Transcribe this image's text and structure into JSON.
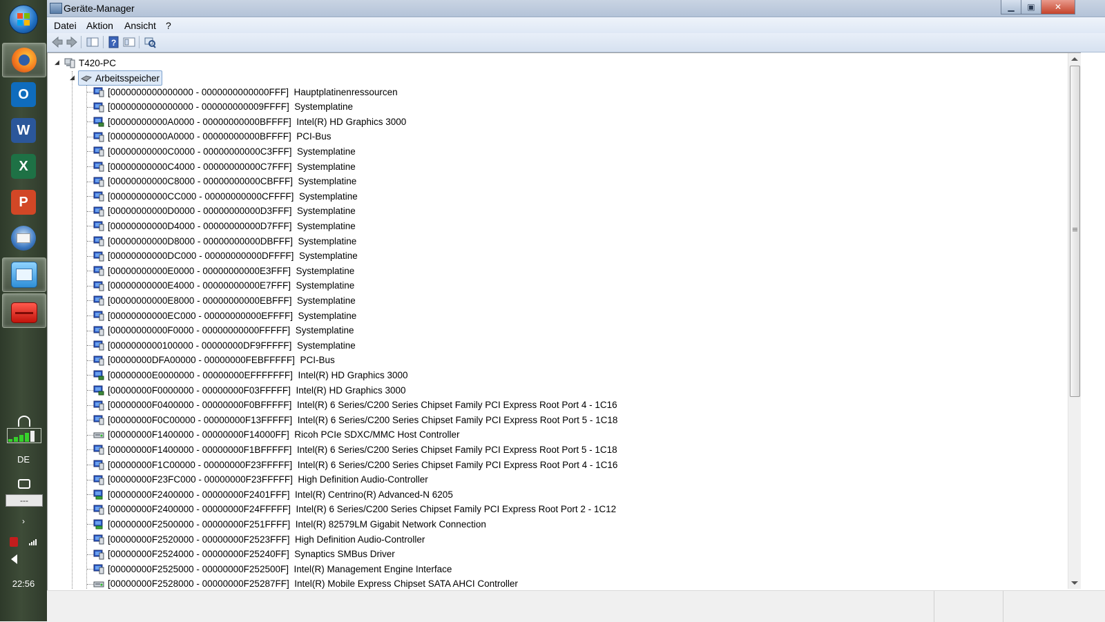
{
  "window": {
    "title": "Geräte-Manager"
  },
  "menu": [
    {
      "label": "Datei"
    },
    {
      "label": "Aktion"
    },
    {
      "label": "Ansicht"
    },
    {
      "label": "?"
    }
  ],
  "tree": {
    "root_label": "T420-PC",
    "category_label": "Arbeitsspeicher",
    "rows": [
      {
        "range": "[0000000000000000 - 0000000000000FFF]",
        "device": "Hauptplatinenressourcen",
        "icon": "monitor-icon"
      },
      {
        "range": "[0000000000000000 - 000000000009FFFF]",
        "device": "Systemplatine",
        "icon": "monitor-icon"
      },
      {
        "range": "[00000000000A0000 - 00000000000BFFFF]",
        "device": "Intel(R) HD Graphics 3000",
        "icon": "display-adapter-icon"
      },
      {
        "range": "[00000000000A0000 - 00000000000BFFFF]",
        "device": "PCI-Bus",
        "icon": "monitor-icon"
      },
      {
        "range": "[00000000000C0000 - 00000000000C3FFF]",
        "device": "Systemplatine",
        "icon": "monitor-icon"
      },
      {
        "range": "[00000000000C4000 - 00000000000C7FFF]",
        "device": "Systemplatine",
        "icon": "monitor-icon"
      },
      {
        "range": "[00000000000C8000 - 00000000000CBFFF]",
        "device": "Systemplatine",
        "icon": "monitor-icon"
      },
      {
        "range": "[00000000000CC000 - 00000000000CFFFF]",
        "device": "Systemplatine",
        "icon": "monitor-icon"
      },
      {
        "range": "[00000000000D0000 - 00000000000D3FFF]",
        "device": "Systemplatine",
        "icon": "monitor-icon"
      },
      {
        "range": "[00000000000D4000 - 00000000000D7FFF]",
        "device": "Systemplatine",
        "icon": "monitor-icon"
      },
      {
        "range": "[00000000000D8000 - 00000000000DBFFF]",
        "device": "Systemplatine",
        "icon": "monitor-icon"
      },
      {
        "range": "[00000000000DC000 - 00000000000DFFFF]",
        "device": "Systemplatine",
        "icon": "monitor-icon"
      },
      {
        "range": "[00000000000E0000 - 00000000000E3FFF]",
        "device": "Systemplatine",
        "icon": "monitor-icon"
      },
      {
        "range": "[00000000000E4000 - 00000000000E7FFF]",
        "device": "Systemplatine",
        "icon": "monitor-icon"
      },
      {
        "range": "[00000000000E8000 - 00000000000EBFFF]",
        "device": "Systemplatine",
        "icon": "monitor-icon"
      },
      {
        "range": "[00000000000EC000 - 00000000000EFFFF]",
        "device": "Systemplatine",
        "icon": "monitor-icon"
      },
      {
        "range": "[00000000000F0000 - 00000000000FFFFF]",
        "device": "Systemplatine",
        "icon": "monitor-icon"
      },
      {
        "range": "[0000000000100000 - 00000000DF9FFFFF]",
        "device": "Systemplatine",
        "icon": "monitor-icon"
      },
      {
        "range": "[00000000DFA00000 - 00000000FEBFFFFF]",
        "device": "PCI-Bus",
        "icon": "monitor-icon"
      },
      {
        "range": "[00000000E0000000 - 00000000EFFFFFFF]",
        "device": "Intel(R) HD Graphics 3000",
        "icon": "display-adapter-icon"
      },
      {
        "range": "[00000000F0000000 - 00000000F03FFFFF]",
        "device": "Intel(R) HD Graphics 3000",
        "icon": "display-adapter-icon"
      },
      {
        "range": "[00000000F0400000 - 00000000F0BFFFFF]",
        "device": "Intel(R) 6 Series/C200 Series Chipset Family PCI Express Root Port 4 - 1C16",
        "icon": "monitor-icon"
      },
      {
        "range": "[00000000F0C00000 - 00000000F13FFFFF]",
        "device": "Intel(R) 6 Series/C200 Series Chipset Family PCI Express Root Port 5 - 1C18",
        "icon": "monitor-icon"
      },
      {
        "range": "[00000000F1400000 - 00000000F14000FF]",
        "device": "Ricoh PCIe SDXC/MMC Host Controller",
        "icon": "drive-controller-icon"
      },
      {
        "range": "[00000000F1400000 - 00000000F1BFFFFF]",
        "device": "Intel(R) 6 Series/C200 Series Chipset Family PCI Express Root Port 5 - 1C18",
        "icon": "monitor-icon"
      },
      {
        "range": "[00000000F1C00000 - 00000000F23FFFFF]",
        "device": "Intel(R) 6 Series/C200 Series Chipset Family PCI Express Root Port 4 - 1C16",
        "icon": "monitor-icon"
      },
      {
        "range": "[00000000F23FC000 - 00000000F23FFFFF]",
        "device": "High Definition Audio-Controller",
        "icon": "monitor-icon"
      },
      {
        "range": "[00000000F2400000 - 00000000F2401FFF]",
        "device": "Intel(R) Centrino(R) Advanced-N 6205",
        "icon": "network-adapter-icon"
      },
      {
        "range": "[00000000F2400000 - 00000000F24FFFFF]",
        "device": "Intel(R) 6 Series/C200 Series Chipset Family PCI Express Root Port 2 - 1C12",
        "icon": "monitor-icon"
      },
      {
        "range": "[00000000F2500000 - 00000000F251FFFF]",
        "device": "Intel(R) 82579LM Gigabit Network Connection",
        "icon": "network-adapter-icon"
      },
      {
        "range": "[00000000F2520000 - 00000000F2523FFF]",
        "device": "High Definition Audio-Controller",
        "icon": "monitor-icon"
      },
      {
        "range": "[00000000F2524000 - 00000000F25240FF]",
        "device": "Synaptics SMBus Driver",
        "icon": "monitor-icon"
      },
      {
        "range": "[00000000F2525000 - 00000000F252500F]",
        "device": "Intel(R) Management Engine Interface",
        "icon": "monitor-icon"
      },
      {
        "range": "[00000000F2528000 - 00000000F25287FF]",
        "device": "Intel(R) Mobile Express Chipset SATA AHCI Controller",
        "icon": "drive-controller-icon"
      }
    ]
  },
  "tray": {
    "language": "DE",
    "battery": "---",
    "clock": "22:56"
  },
  "colors": {
    "selection_bg": "#dde9f7",
    "selection_border": "#7da2ce",
    "titlebar": "#bfcce0"
  }
}
